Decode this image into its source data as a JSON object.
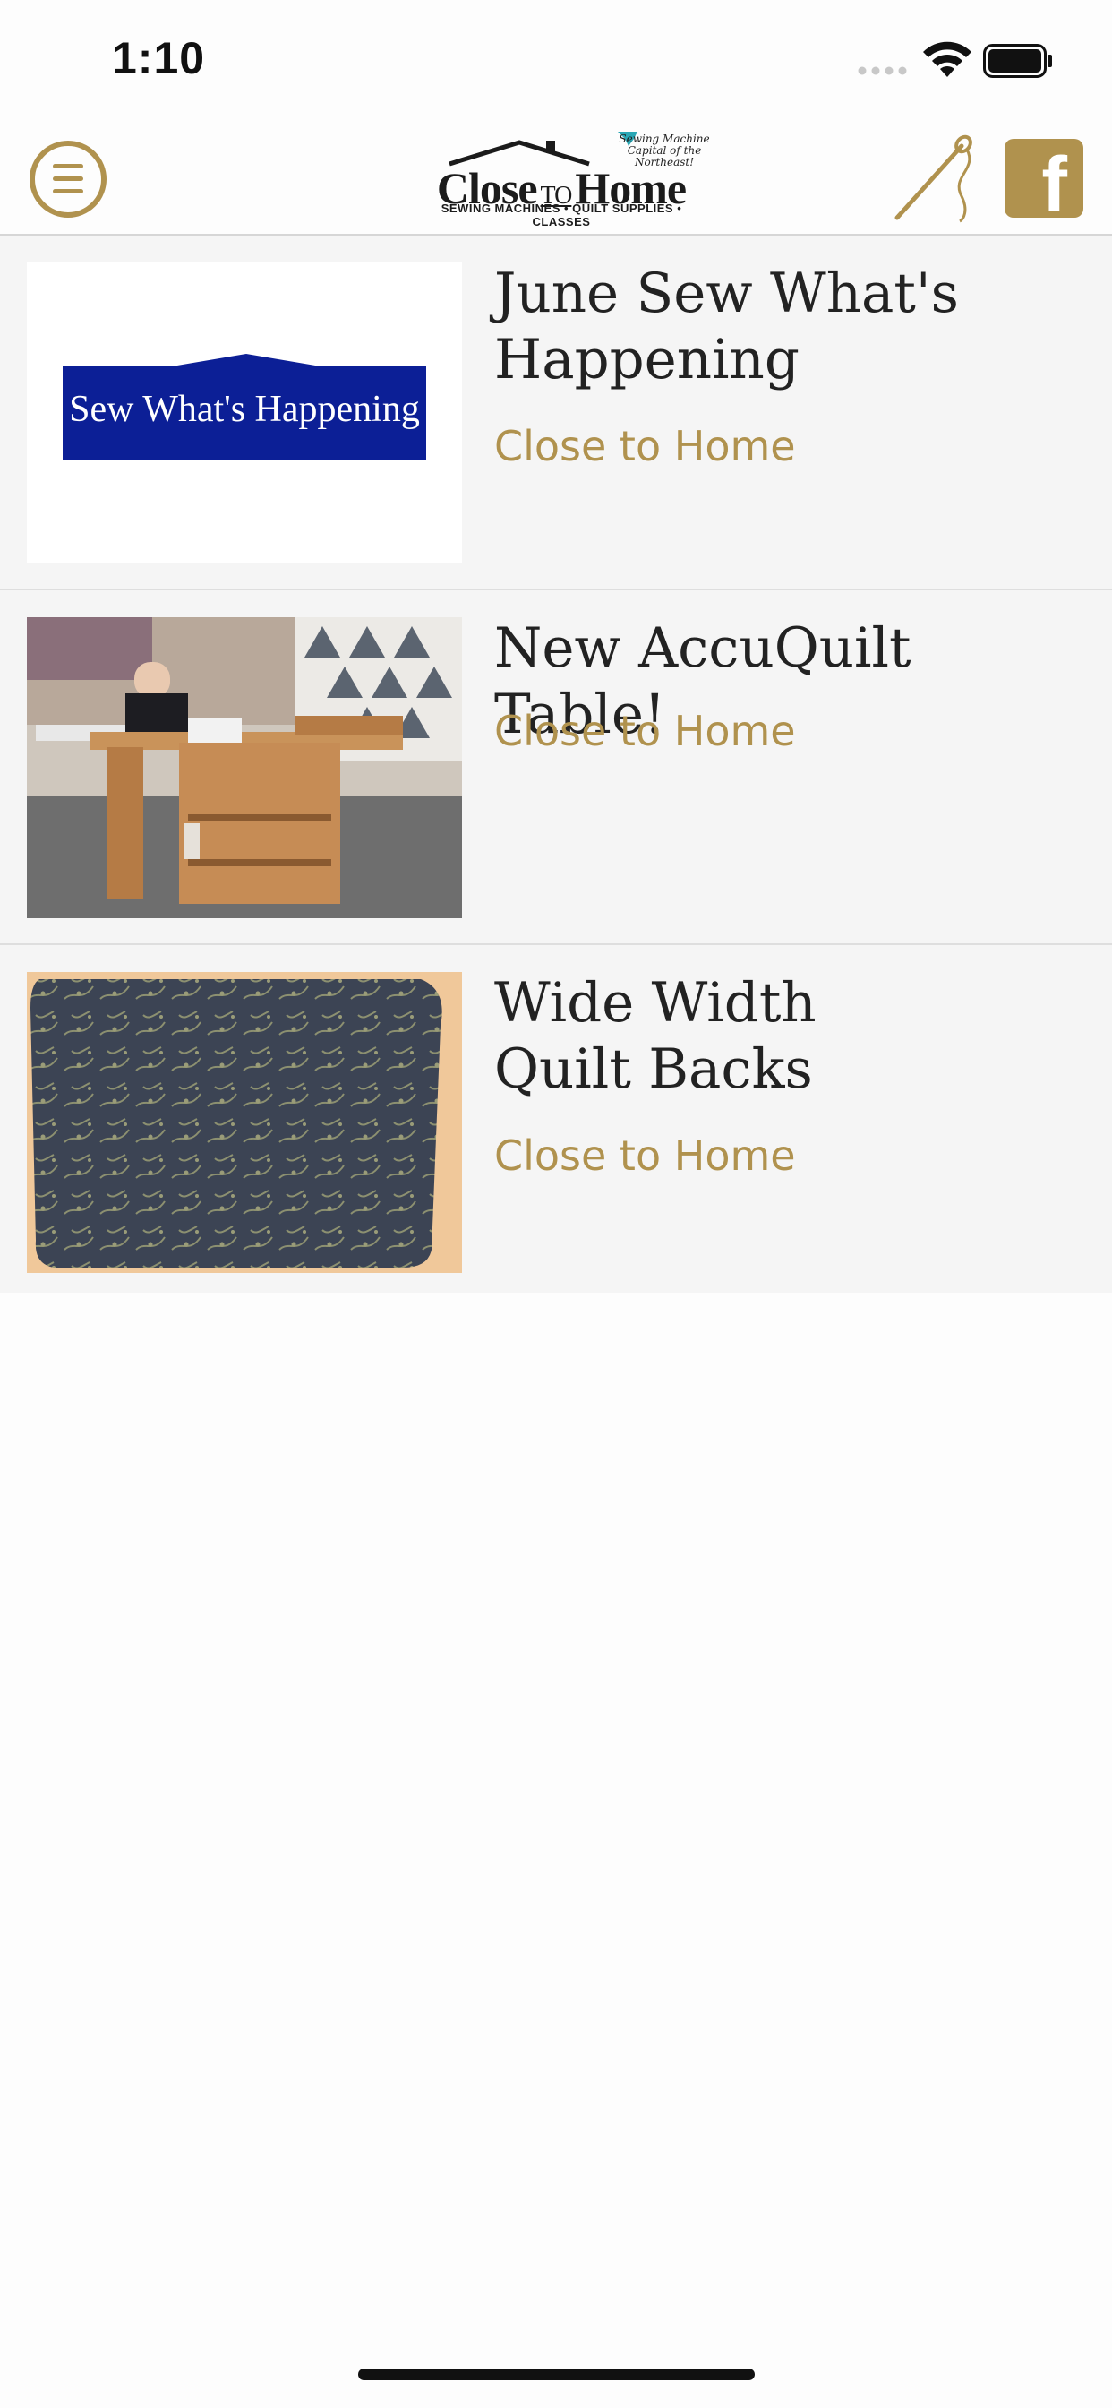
{
  "status_bar": {
    "time": "1:10"
  },
  "header": {
    "logo": {
      "tagline": "Sewing Machine Capital of the Northeast!",
      "name_part1": "Close",
      "name_to": "TO",
      "name_part2": "Home",
      "subtitle": "SEWING MACHINES • QUILT SUPPLIES • CLASSES"
    },
    "accent_color": "#b0924e"
  },
  "feed": {
    "items": [
      {
        "title": "June Sew What's Happening",
        "source": "Close to Home",
        "thumb_text": "Sew What's Happening"
      },
      {
        "title": "New AccuQuilt Table!",
        "source": "Close to Home"
      },
      {
        "title": "Wide Width Quilt Backs",
        "source": "Close to Home"
      }
    ]
  }
}
